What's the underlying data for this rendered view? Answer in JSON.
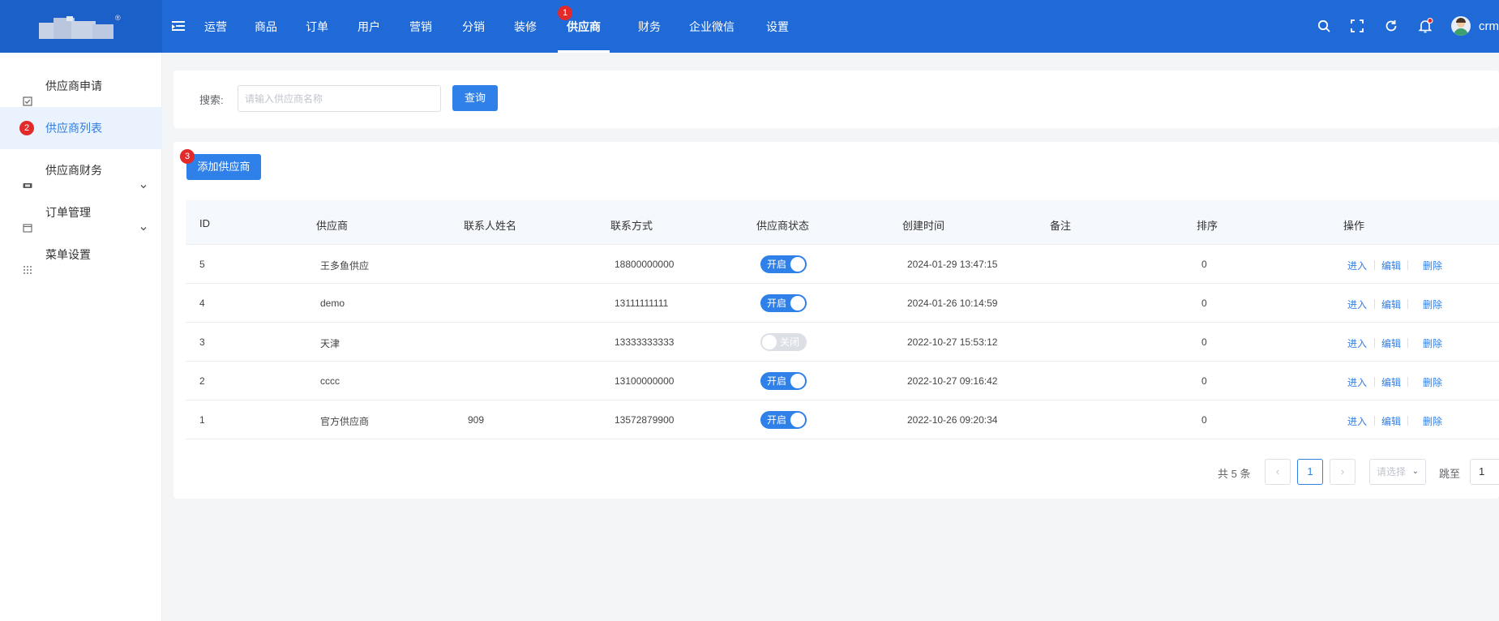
{
  "app": {
    "logo_mark": "®"
  },
  "topnav": {
    "items": [
      "运营",
      "商品",
      "订单",
      "用户",
      "营销",
      "分销",
      "装修",
      "供应商",
      "财务",
      "企业微信",
      "设置"
    ],
    "active_index": 7,
    "active_badge": "1"
  },
  "toolbar": {
    "icons": [
      "search-icon",
      "fullscreen-icon",
      "refresh-icon",
      "bell-icon"
    ],
    "user_name": "crm"
  },
  "sidebar": {
    "items": [
      {
        "label": "供应商申请",
        "icon": "checkbox-icon",
        "active": false,
        "expandable": false
      },
      {
        "label": "供应商列表",
        "icon": "list-icon",
        "active": true,
        "expandable": false,
        "badge": "2"
      },
      {
        "label": "供应商财务",
        "icon": "wallet-icon",
        "active": false,
        "expandable": true
      },
      {
        "label": "订单管理",
        "icon": "order-icon",
        "active": false,
        "expandable": true
      },
      {
        "label": "菜单设置",
        "icon": "grid-icon",
        "active": false,
        "expandable": false
      }
    ]
  },
  "search": {
    "label": "搜索:",
    "placeholder": "请输入供应商名称",
    "value": "",
    "button": "查询"
  },
  "actions": {
    "add_button": "添加供应商",
    "add_badge": "3"
  },
  "table": {
    "columns": [
      "ID",
      "供应商",
      "联系人姓名",
      "联系方式",
      "供应商状态",
      "创建时间",
      "备注",
      "排序",
      "操作"
    ],
    "rows": [
      {
        "id": "5",
        "name": "王多鱼供应",
        "contact": "",
        "phone": "18800000000",
        "status": "开启",
        "enabled": true,
        "created": "2024-01-29 13:47:15",
        "remark": "",
        "sort": "0"
      },
      {
        "id": "4",
        "name": "demo",
        "contact": "",
        "phone": "13111111111",
        "status": "开启",
        "enabled": true,
        "created": "2024-01-26 10:14:59",
        "remark": "",
        "sort": "0"
      },
      {
        "id": "3",
        "name": "天津",
        "contact": "",
        "phone": "13333333333",
        "status": "关闭",
        "enabled": false,
        "created": "2022-10-27 15:53:12",
        "remark": "",
        "sort": "0"
      },
      {
        "id": "2",
        "name": "cccc",
        "contact": "",
        "phone": "13100000000",
        "status": "开启",
        "enabled": true,
        "created": "2022-10-27 09:16:42",
        "remark": "",
        "sort": "0"
      },
      {
        "id": "1",
        "name": "官方供应商",
        "contact": "909",
        "phone": "13572879900",
        "status": "开启",
        "enabled": true,
        "created": "2022-10-26 09:20:34",
        "remark": "",
        "sort": "0"
      }
    ],
    "ops": [
      "进入",
      "编辑",
      "删除"
    ]
  },
  "pagination": {
    "total": "共 5 条",
    "current_page": "1",
    "page_size_placeholder": "请选择",
    "jump_label": "跳至",
    "jump_value": "1"
  },
  "colors": {
    "primary": "#2f80e8",
    "topbar": "#1f6ad6",
    "badge": "#e22a2a"
  }
}
